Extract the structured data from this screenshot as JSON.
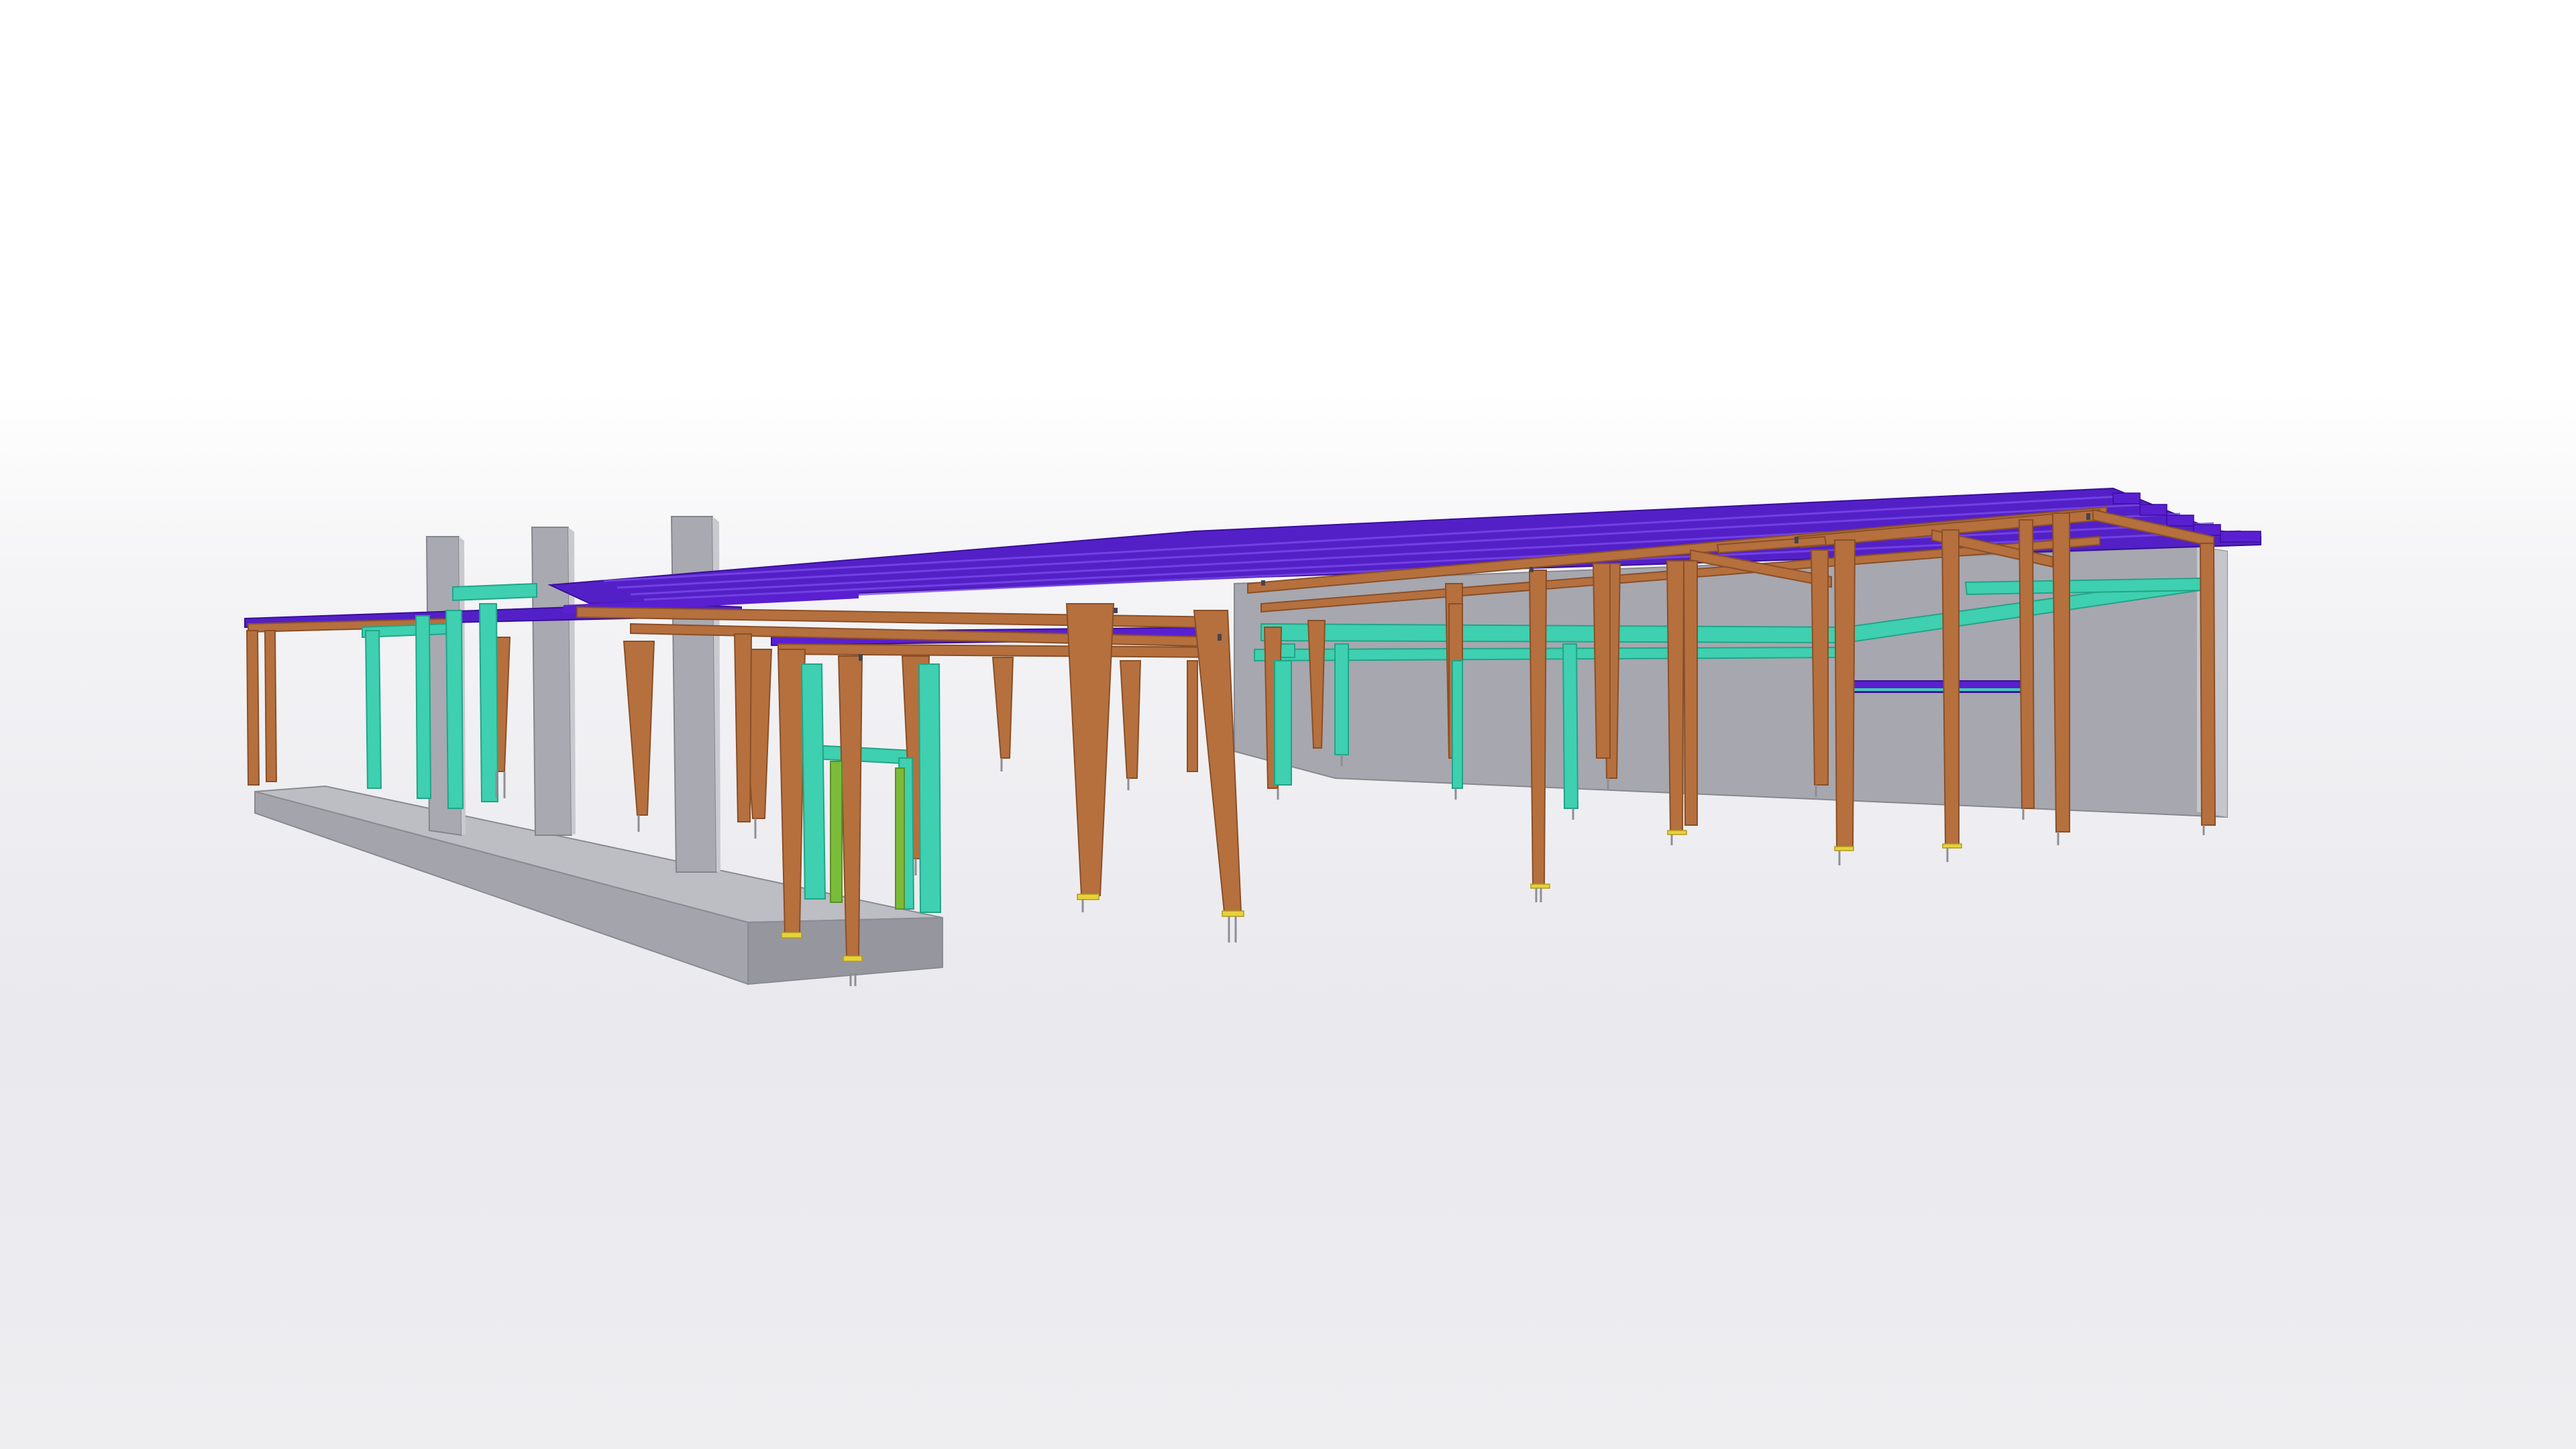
{
  "viewer": {
    "mode": "3d-model-view"
  },
  "colors": {
    "background_top": "#ffffff",
    "background_bottom": "#e9e9ee",
    "timber": "#b5703e",
    "timber_dark": "#8a4f28",
    "timber_light": "#cd8a55",
    "steel_cyan": "#3ed0b0",
    "steel_cyan_dark": "#22a488",
    "purlin_purple": "#5a1fd1",
    "purlin_purple_dark": "#3a0f98",
    "concrete": "#a9a9b1",
    "concrete_dark": "#8d8d96",
    "concrete_light": "#c2c2c9",
    "green_member": "#7bbb3a",
    "base_plate": "#e8d23a"
  }
}
